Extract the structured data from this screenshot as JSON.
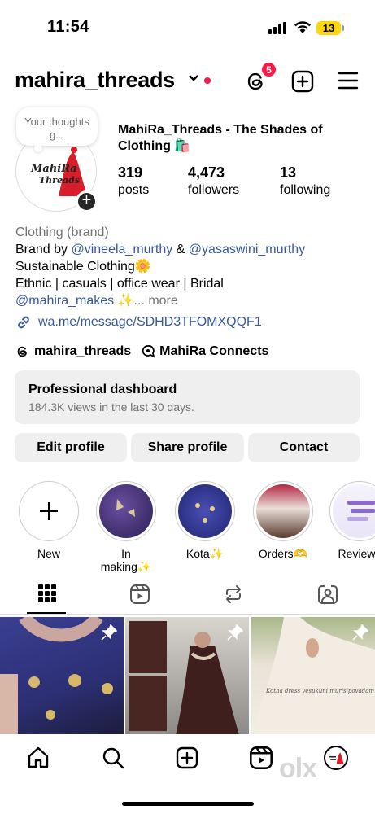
{
  "status_bar": {
    "time": "11:54",
    "battery": "13"
  },
  "header": {
    "username": "mahira_threads",
    "threads_badge": "5"
  },
  "profile": {
    "note": "Your thoughts g...",
    "avatar_logo": "MahiRa Threads",
    "display_name": "MahiRa_Threads - The Shades of Clothing 🛍️",
    "posts_count": "319",
    "posts_label": "posts",
    "followers_count": "4,473",
    "followers_label": "followers",
    "following_count": "13",
    "following_label": "following"
  },
  "bio": {
    "category": "Clothing (brand)",
    "line1_prefix": "Brand by ",
    "mention1": "@vineela_murthy",
    "line1_mid": " & ",
    "mention2": "@yasaswini_murthy",
    "line2": "Sustainable Clothing🌼",
    "line3": "Ethnic | casuals | office wear | Bridal",
    "mention3": "@mahira_makes",
    "line4_suffix": " ✨",
    "more": "... more",
    "link": "wa.me/message/SDHD3TFOMXQQF1",
    "threads_handle": "mahira_threads",
    "channel": "MahiRa Connects"
  },
  "dashboard": {
    "title": "Professional dashboard",
    "subtitle": "184.3K views in the last 30 days."
  },
  "buttons": {
    "edit": "Edit profile",
    "share": "Share profile",
    "contact": "Contact"
  },
  "highlights": [
    {
      "label": "New"
    },
    {
      "label": "In making✨"
    },
    {
      "label": "Kota✨"
    },
    {
      "label": "Orders🫶"
    },
    {
      "label": "Reviews"
    }
  ],
  "tabs": [
    {
      "icon": "grid-icon"
    },
    {
      "icon": "reels-icon"
    },
    {
      "icon": "reposts-icon"
    },
    {
      "icon": "tagged-icon"
    }
  ],
  "grid_text": "Kotha dress vesukuni murisipovadam",
  "watermark": "olx",
  "colors": {
    "accent_red": "#ff1744",
    "link": "#385898",
    "button_bg": "#efefef",
    "muted": "#737373"
  }
}
